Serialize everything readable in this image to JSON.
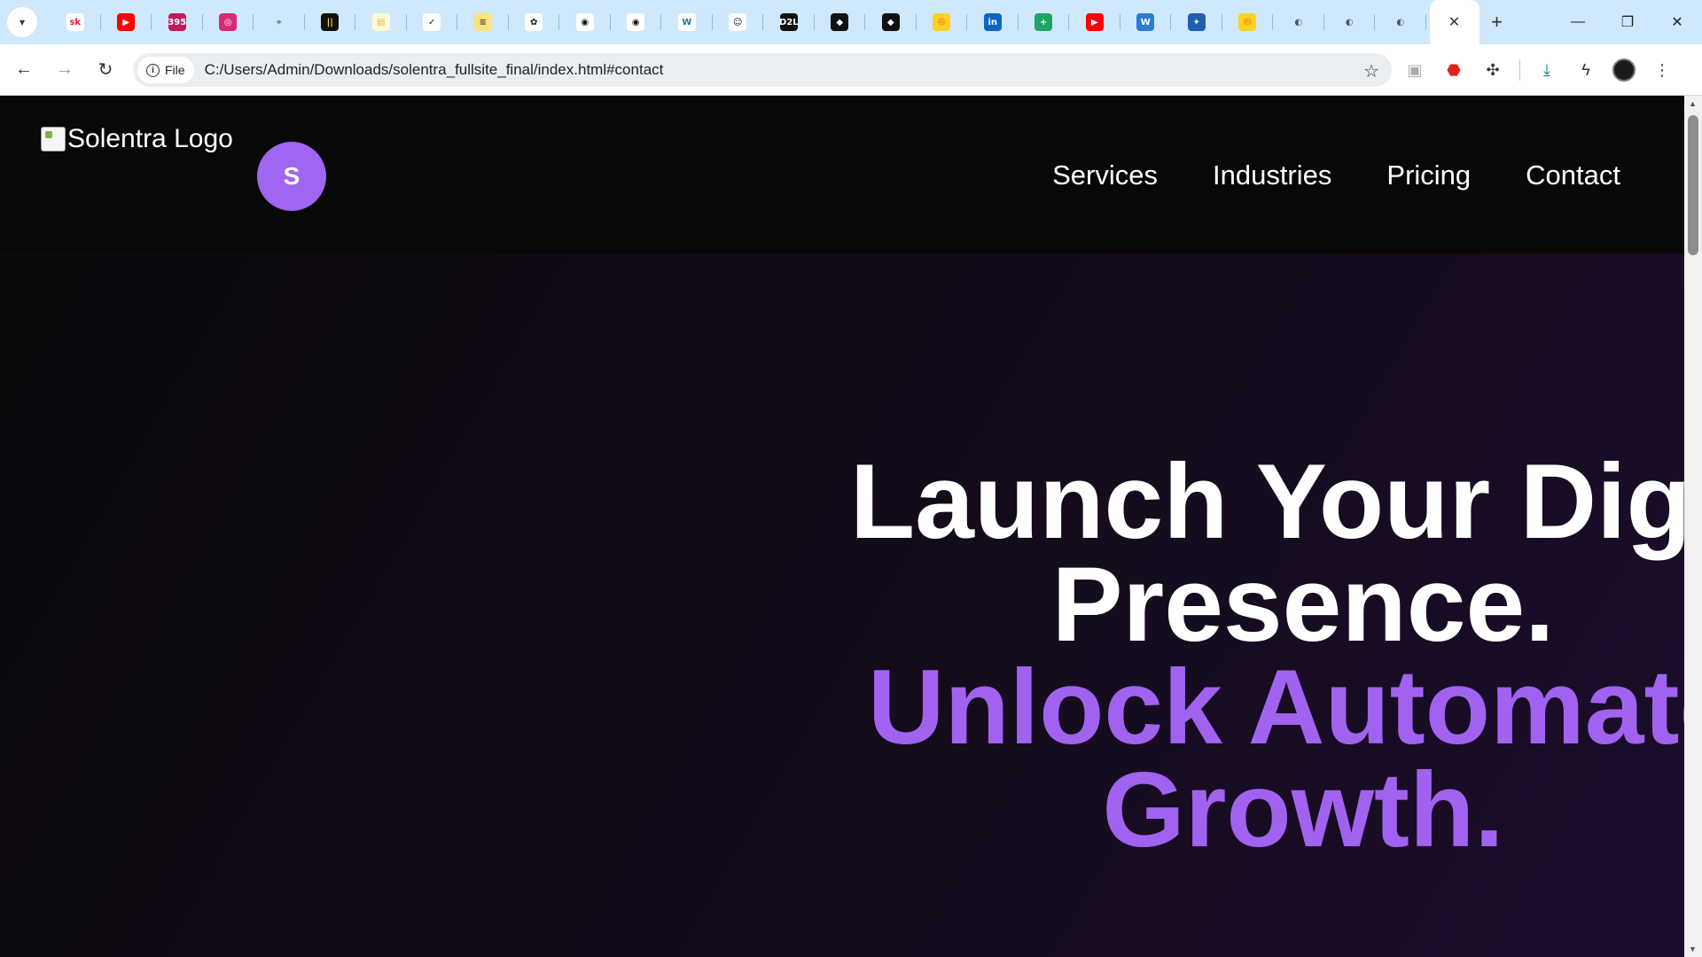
{
  "browser": {
    "tabs": [
      {
        "name": "skillshare-tab",
        "glyph": "sk",
        "color": "#e8193c",
        "bg": "#ffffff"
      },
      {
        "name": "youtube-tab",
        "glyph": "▶",
        "color": "#ffffff",
        "bg": "#ff0000"
      },
      {
        "name": "counter-tab",
        "glyph": "395",
        "color": "#ffffff",
        "bg": "#c2185b"
      },
      {
        "name": "instagram-tab",
        "glyph": "◎",
        "color": "#ffffff",
        "bg": "#d62976"
      },
      {
        "name": "extension-tab",
        "glyph": "⌖",
        "color": "#4b9d8c",
        "bg": "#cfe8fb"
      },
      {
        "name": "meter-tab",
        "glyph": "||",
        "color": "#f5d742",
        "bg": "#111111"
      },
      {
        "name": "notes-tab",
        "glyph": "▤",
        "color": "#d6b94a",
        "bg": "#fff8d6"
      },
      {
        "name": "tasks-tab",
        "glyph": "✓",
        "color": "#222222",
        "bg": "#ffffff"
      },
      {
        "name": "docs-tab",
        "glyph": "≡",
        "color": "#444444",
        "bg": "#ffe27a"
      },
      {
        "name": "openai-tab",
        "glyph": "✿",
        "color": "#111111",
        "bg": "#ffffff"
      },
      {
        "name": "github-tab-1",
        "glyph": "◉",
        "color": "#111111",
        "bg": "#ffffff"
      },
      {
        "name": "github-tab-2",
        "glyph": "◉",
        "color": "#111111",
        "bg": "#ffffff"
      },
      {
        "name": "wordpress-tab",
        "glyph": "W",
        "color": "#21759b",
        "bg": "#ffffff"
      },
      {
        "name": "cat-tab",
        "glyph": "☺",
        "color": "#111111",
        "bg": "#ffffff"
      },
      {
        "name": "d2l-tab",
        "glyph": "D2L",
        "color": "#ffffff",
        "bg": "#111111"
      },
      {
        "name": "cube-tab-1",
        "glyph": "◆",
        "color": "#ffffff",
        "bg": "#111111"
      },
      {
        "name": "cube-tab-2",
        "glyph": "◆",
        "color": "#ffffff",
        "bg": "#111111"
      },
      {
        "name": "huggingface-tab",
        "glyph": "☻",
        "color": "#f5a623",
        "bg": "#ffd21e"
      },
      {
        "name": "linkedin-tab",
        "glyph": "in",
        "color": "#ffffff",
        "bg": "#0a66c2"
      },
      {
        "name": "sheets-tab",
        "glyph": "+",
        "color": "#ffffff",
        "bg": "#1fa463"
      },
      {
        "name": "youtube-tab-2",
        "glyph": "▶",
        "color": "#ffffff",
        "bg": "#ff0000"
      },
      {
        "name": "word-tab",
        "glyph": "W",
        "color": "#ffffff",
        "bg": "#2b7cd3"
      },
      {
        "name": "bot-tab",
        "glyph": "✦",
        "color": "#ffffff",
        "bg": "#1e5fb3"
      },
      {
        "name": "huggingface-tab-2",
        "glyph": "☻",
        "color": "#f5a623",
        "bg": "#ffd21e"
      },
      {
        "name": "globe-tab-1",
        "glyph": "◐",
        "color": "#555555",
        "bg": "#cfe8fb"
      },
      {
        "name": "globe-tab-2",
        "glyph": "◐",
        "color": "#555555",
        "bg": "#cfe8fb"
      },
      {
        "name": "globe-tab-3",
        "glyph": "◐",
        "color": "#555555",
        "bg": "#cfe8fb"
      }
    ],
    "file_chip_label": "File",
    "url": "C:/Users/Admin/Downloads/solentra_fullsite_final/index.html#contact"
  },
  "site": {
    "logo_alt": "Solentra Logo",
    "avatar_letter": "S",
    "nav": [
      "Services",
      "Industries",
      "Pricing",
      "Contact"
    ],
    "hero": {
      "line1": "Launch Your Digit",
      "line2": "Presence.",
      "line3": "Unlock Automate",
      "line4": "Growth."
    },
    "colors": {
      "accent": "#a262f0",
      "header_bg": "#080808",
      "avatar_bg": "#a066f2"
    }
  }
}
